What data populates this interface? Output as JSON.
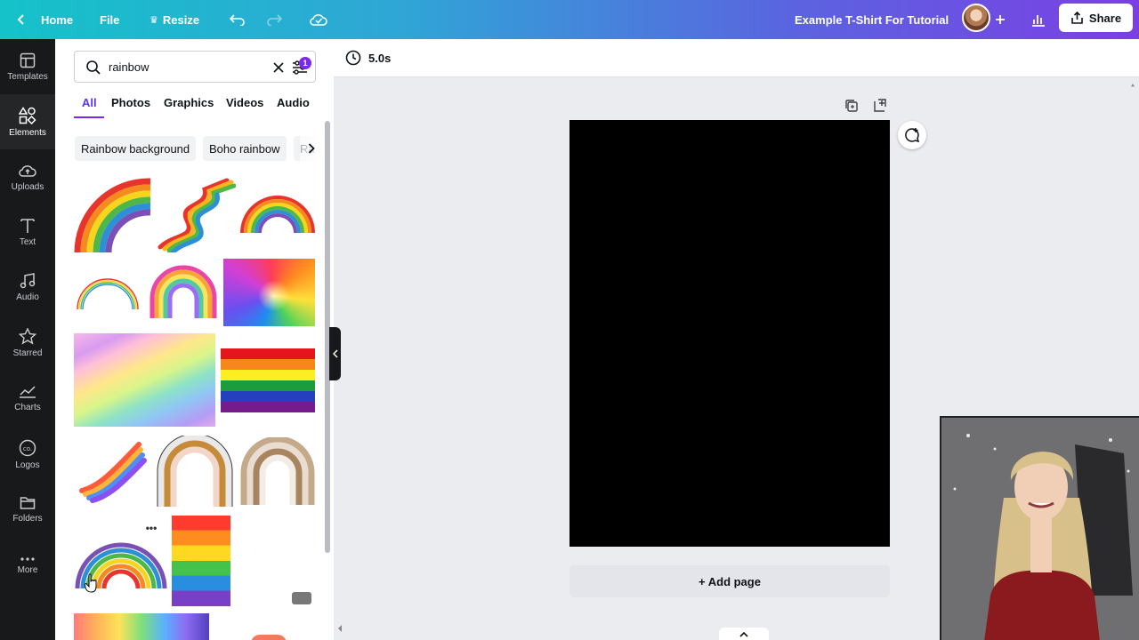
{
  "topbar": {
    "home_label": "Home",
    "file_label": "File",
    "resize_label": "Resize",
    "doc_title": "Example T-Shirt For Tutorial",
    "share_label": "Share"
  },
  "rail": {
    "items": [
      {
        "label": "Templates",
        "icon": "templates-icon"
      },
      {
        "label": "Elements",
        "icon": "elements-icon"
      },
      {
        "label": "Uploads",
        "icon": "uploads-icon"
      },
      {
        "label": "Text",
        "icon": "text-icon"
      },
      {
        "label": "Audio",
        "icon": "audio-icon"
      },
      {
        "label": "Starred",
        "icon": "star-icon"
      },
      {
        "label": "Charts",
        "icon": "charts-icon"
      },
      {
        "label": "Logos",
        "icon": "logos-icon"
      },
      {
        "label": "Folders",
        "icon": "folder-icon"
      },
      {
        "label": "More",
        "icon": "more-icon"
      }
    ],
    "active": "Elements"
  },
  "search": {
    "query": "rainbow",
    "filter_count": "1"
  },
  "tabs": [
    {
      "label": "All"
    },
    {
      "label": "Photos"
    },
    {
      "label": "Graphics"
    },
    {
      "label": "Videos"
    },
    {
      "label": "Audio"
    }
  ],
  "active_tab": "All",
  "chips": [
    {
      "label": "Rainbow background"
    },
    {
      "label": "Boho rainbow"
    },
    {
      "label": "Ra"
    }
  ],
  "canvas": {
    "duration": "5.0s",
    "add_page_label": "+ Add page"
  },
  "colors": {
    "accent": "#7d2ae8",
    "page_background": "#000000"
  }
}
